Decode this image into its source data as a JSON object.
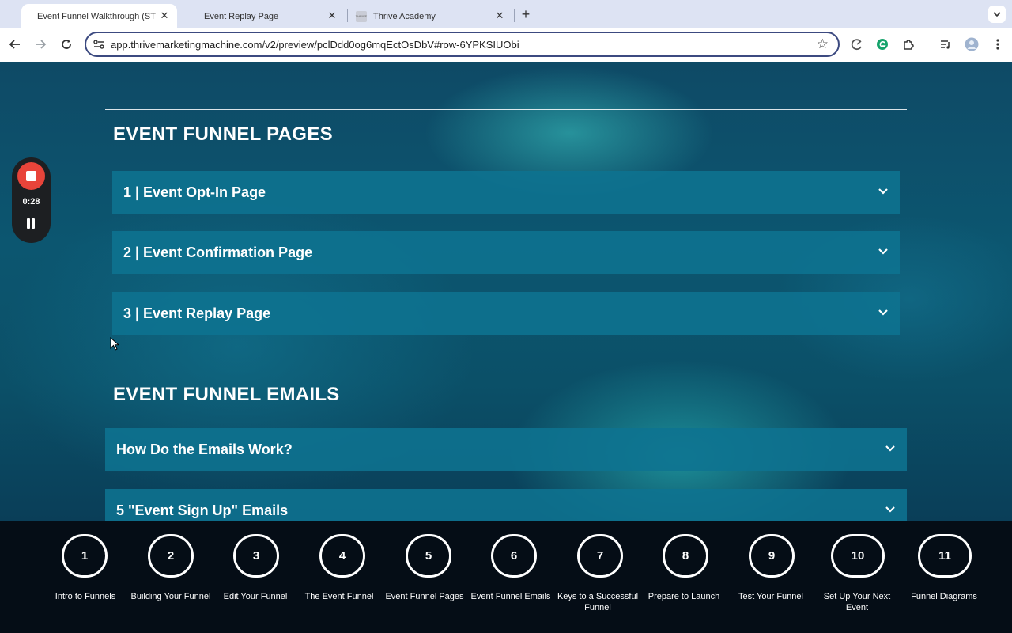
{
  "browser": {
    "tabs": [
      {
        "title": "Event Funnel Walkthrough (ST",
        "active": true
      },
      {
        "title": "Event Replay Page",
        "active": false
      },
      {
        "title": "Thrive Academy",
        "active": false
      }
    ],
    "close_glyph": "✕",
    "newtab_glyph": "+",
    "url": "app.thrivemarketingmachine.com/v2/preview/pclDdd0og6mqEctOsDbV#row-6YPKSIUObi",
    "favicon_text": "THRIVE"
  },
  "recorder": {
    "time": "0:28"
  },
  "sections": {
    "pages": {
      "heading": "EVENT FUNNEL PAGES",
      "items": [
        {
          "label": "1 | Event Opt-In Page"
        },
        {
          "label": "2 | Event Confirmation Page"
        },
        {
          "label": "3 | Event Replay Page"
        }
      ]
    },
    "emails": {
      "heading": "EVENT FUNNEL EMAILS",
      "items": [
        {
          "label": "How Do the Emails Work?"
        },
        {
          "label": "5 \"Event Sign Up\" Emails"
        }
      ]
    }
  },
  "steps": [
    {
      "number": "1",
      "label": "Intro to Funnels"
    },
    {
      "number": "2",
      "label": "Building Your Funnel"
    },
    {
      "number": "3",
      "label": "Edit Your Funnel"
    },
    {
      "number": "4",
      "label": "The Event Funnel"
    },
    {
      "number": "5",
      "label": "Event Funnel Pages"
    },
    {
      "number": "6",
      "label": "Event Funnel Emails"
    },
    {
      "number": "7",
      "label": "Keys to a Successful Funnel"
    },
    {
      "number": "8",
      "label": "Prepare to Launch"
    },
    {
      "number": "9",
      "label": "Test Your Funnel"
    },
    {
      "number": "10",
      "label": "Set Up Your Next Event"
    },
    {
      "number": "11",
      "label": "Funnel Diagrams"
    }
  ]
}
